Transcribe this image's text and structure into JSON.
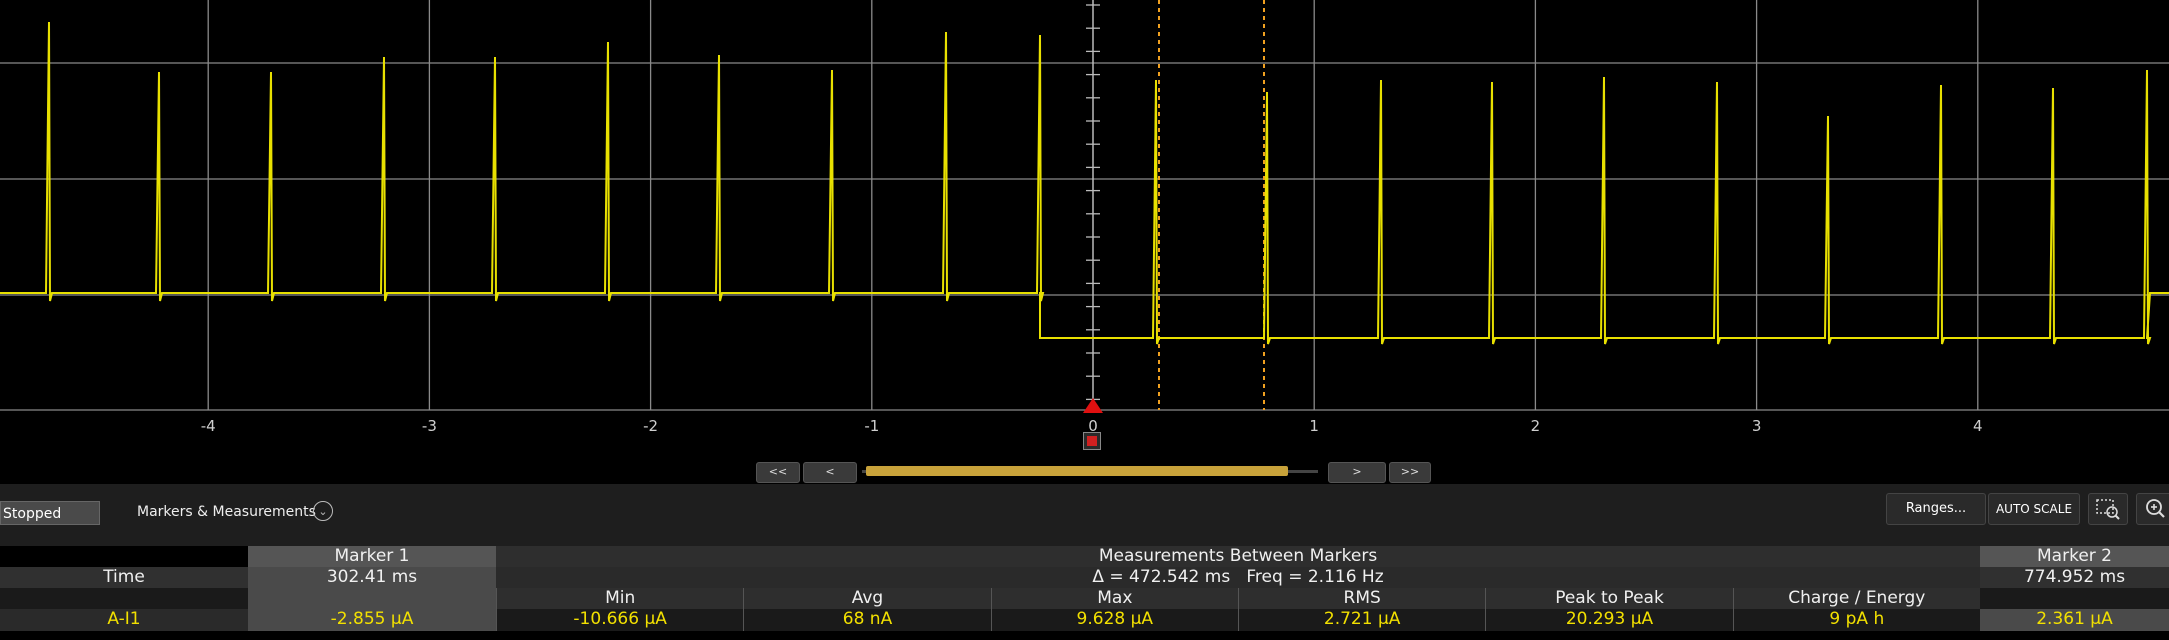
{
  "scope": {
    "x_ticks": [
      "-4",
      "-3",
      "-2",
      "-1",
      "0",
      "1",
      "2",
      "3",
      "4"
    ],
    "signal_color": "#e8e000",
    "marker_color": "#f0a020",
    "grid_color": "#8a8a8a"
  },
  "scroll": {
    "btn_first": "<<",
    "btn_prev": "<",
    "btn_next": ">",
    "btn_last": ">>"
  },
  "toolbar": {
    "status": "Stopped",
    "markers_label": "Markers & Measurements",
    "ranges_button": "Ranges...",
    "autoscale_button": "AUTO SCALE"
  },
  "table": {
    "marker1_header": "Marker 1",
    "measurements_header": "Measurements Between Markers",
    "marker2_header": "Marker 2",
    "time_label": "Time",
    "marker1_time": "302.41 ms",
    "delta_freq": "Δ = 472.542 ms   Freq = 2.116 Hz",
    "marker2_time": "774.952 ms",
    "columns": [
      "Min",
      "Avg",
      "Max",
      "RMS",
      "Peak to Peak",
      "Charge / Energy"
    ],
    "channel": "A-I1",
    "marker1_value": "-2.855 µA",
    "values": [
      "-10.666 µA",
      "68 nA",
      "9.628 µA",
      "2.721 µA",
      "20.293 µA",
      "9 pA h"
    ],
    "marker2_value": "2.361 µA"
  }
}
